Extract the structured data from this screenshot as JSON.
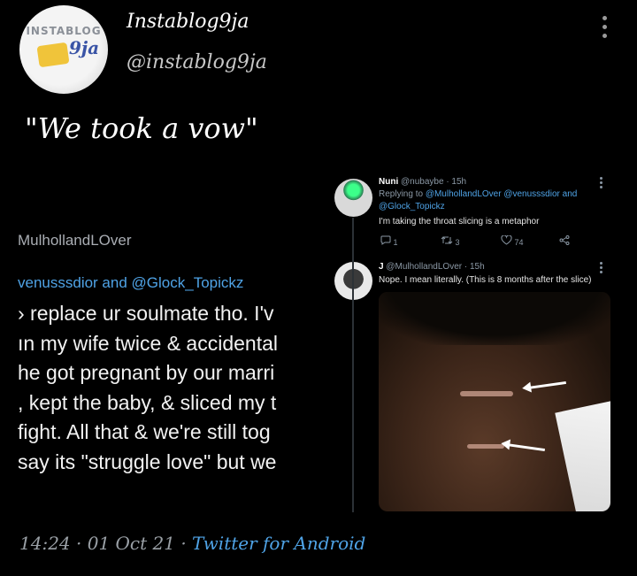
{
  "account": {
    "display_name": "Instablog9ja",
    "handle": "@instablog9ja",
    "avatar_text_top": "INSTABLOG",
    "avatar_text_bottom": "9ja"
  },
  "tweet": {
    "text": "\"We took a vow\"",
    "time": "14:24",
    "date": "01 Oct 21",
    "source": "Twitter for Android"
  },
  "embedded_left": {
    "handle": "MulhollandLOver",
    "mention": "venusssdior and @Glock_Topickz",
    "lines": [
      "› replace ur soulmate tho. I'v",
      "ın my wife twice & accidental",
      "he got pregnant by our marri",
      ", kept the baby, & sliced my t",
      "fight. All that & we're still tog",
      "say its \"struggle love\" but we"
    ]
  },
  "replies": [
    {
      "name": "Nuni",
      "handle": "@nubaybe",
      "time": "· 15h",
      "replying_label": "Replying to",
      "replying_to_1": "@MulhollandLOver @venusssdior and",
      "replying_to_2": "@Glock_Topickz",
      "text": "I'm taking the throat slicing is a metaphor",
      "replies": "1",
      "retweets": "3",
      "likes": "74"
    },
    {
      "name": "J",
      "handle": "@MulhollandLOver",
      "time": "· 15h",
      "text": "Nope. I mean literally. (This is 8 months after the slice)"
    }
  ],
  "colors": {
    "background": "#000000",
    "link": "#4fa3e6",
    "secondary_text": "#8b98a5"
  },
  "icons": [
    "more-icon",
    "reply-icon",
    "retweet-icon",
    "like-icon",
    "share-icon"
  ]
}
